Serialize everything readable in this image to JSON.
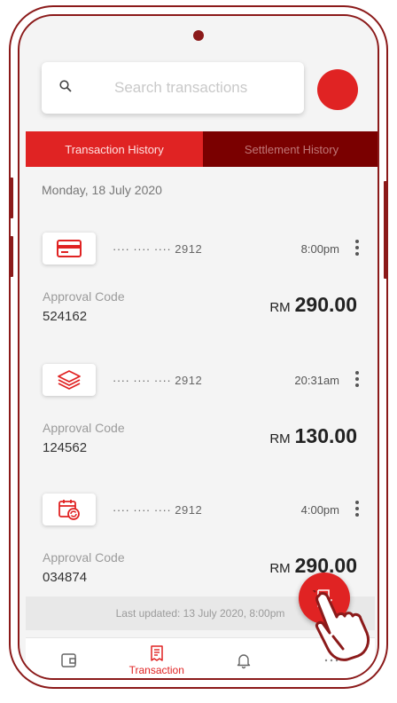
{
  "search": {
    "placeholder": "Search transactions"
  },
  "tabs": [
    {
      "label": "Transaction History",
      "active": true
    },
    {
      "label": "Settlement History",
      "active": false
    }
  ],
  "date_header": "Monday, 18 July 2020",
  "transactions": [
    {
      "icon": "credit-card-icon",
      "card": "···· ···· ···· 2912",
      "time": "8:00pm",
      "approval_label": "Approval Code",
      "approval_code": "524162",
      "currency": "RM",
      "amount": "290.00"
    },
    {
      "icon": "layers-icon",
      "card": "···· ···· ···· 2912",
      "time": "20:31am",
      "approval_label": "Approval Code",
      "approval_code": "124562",
      "currency": "RM",
      "amount": "130.00"
    },
    {
      "icon": "calendar-refresh-icon",
      "card": "···· ···· ···· 2912",
      "time": "4:00pm",
      "approval_label": "Approval Code",
      "approval_code": "034874",
      "currency": "RM",
      "amount": "290.00"
    }
  ],
  "last_updated": "Last updated: 13 July 2020, 8:00pm",
  "bottom_nav": [
    {
      "icon": "wallet-icon",
      "label": ""
    },
    {
      "icon": "receipt-icon",
      "label": "Transaction",
      "active": true
    },
    {
      "icon": "bell-icon",
      "label": ""
    },
    {
      "icon": "more-icon",
      "label": ""
    }
  ],
  "fab": {
    "icon": "receipt-check-icon"
  },
  "colors": {
    "accent": "#e02323",
    "dark_accent": "#7a0000",
    "frame": "#8b1a1a"
  }
}
